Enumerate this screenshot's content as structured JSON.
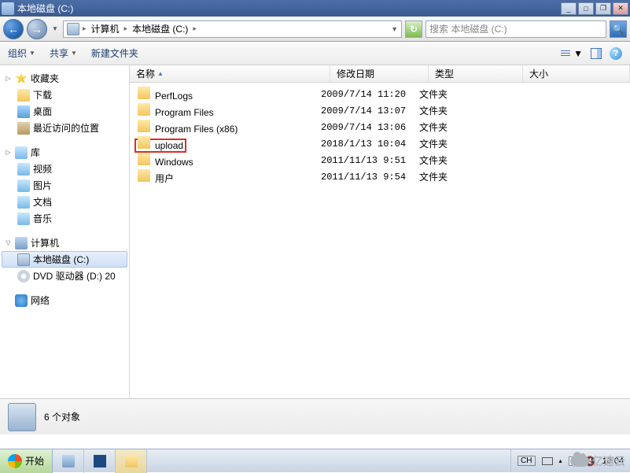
{
  "window": {
    "title": "本地磁盘 (C:)",
    "min": "_",
    "max": "□",
    "restore": "❐",
    "close": "✕"
  },
  "nav": {
    "back": "←",
    "forward": "→",
    "dropdown": "▼",
    "crumb1": "计算机",
    "crumb2": "本地磁盘 (C:)",
    "sep": "▸",
    "end_sep": "▸",
    "refresh": "↻",
    "search_placeholder": "搜索 本地磁盘 (C:)",
    "search_icon": "🔍"
  },
  "toolbar": {
    "organize": "组织",
    "share": "共享",
    "newfolder": "新建文件夹",
    "dd": "▼",
    "help": "?"
  },
  "tree": {
    "favorites": "收藏夹",
    "downloads": "下载",
    "desktop": "桌面",
    "recent": "最近访问的位置",
    "libraries": "库",
    "videos": "视频",
    "pictures": "图片",
    "documents": "文档",
    "music": "音乐",
    "computer": "计算机",
    "drive_c": "本地磁盘 (C:)",
    "dvd": "DVD 驱动器 (D:) 20",
    "network": "网络",
    "collapse": "▷",
    "expand": "▽"
  },
  "columns": {
    "name": "名称",
    "date": "修改日期",
    "type": "类型",
    "size": "大小",
    "sort": "▲"
  },
  "files": [
    {
      "name": "PerfLogs",
      "date": "2009/7/14 11:20",
      "type": "文件夹",
      "hl": false
    },
    {
      "name": "Program Files",
      "date": "2009/7/14 13:07",
      "type": "文件夹",
      "hl": false
    },
    {
      "name": "Program Files (x86)",
      "date": "2009/7/14 13:06",
      "type": "文件夹",
      "hl": false
    },
    {
      "name": "upload",
      "date": "2018/1/13 10:04",
      "type": "文件夹",
      "hl": true
    },
    {
      "name": "Windows",
      "date": "2011/11/13 9:51",
      "type": "文件夹",
      "hl": false
    },
    {
      "name": "用户",
      "date": "2011/11/13 9:54",
      "type": "文件夹",
      "hl": false
    }
  ],
  "status": {
    "count": "6 个对象"
  },
  "taskbar": {
    "start": "开始",
    "lang": "CH",
    "clock": "10:04",
    "tray_up": "▴"
  },
  "watermark": "亿速云"
}
